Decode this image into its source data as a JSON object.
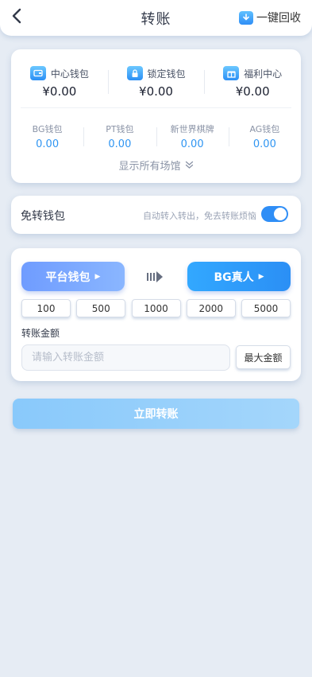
{
  "header": {
    "title": "转账",
    "recall_label": "一键回收"
  },
  "wallets": {
    "main": [
      {
        "name": "中心钱包",
        "amount": "¥0.00",
        "icon": "wallet-icon"
      },
      {
        "name": "锁定钱包",
        "amount": "¥0.00",
        "icon": "lock-icon"
      },
      {
        "name": "福利中心",
        "amount": "¥0.00",
        "icon": "gift-icon"
      }
    ],
    "sub": [
      {
        "name": "BG钱包",
        "amount": "0.00"
      },
      {
        "name": "PT钱包",
        "amount": "0.00"
      },
      {
        "name": "新世界棋牌",
        "amount": "0.00"
      },
      {
        "name": "AG钱包",
        "amount": "0.00"
      }
    ],
    "show_all_label": "显示所有场馆"
  },
  "free_transfer": {
    "title": "免转钱包",
    "desc": "自动转入转出，免去转账烦恼",
    "enabled": true
  },
  "transfer": {
    "from_label": "平台钱包",
    "to_label": "BG真人",
    "amount_options": [
      "100",
      "500",
      "1000",
      "2000",
      "5000"
    ],
    "amount_label": "转账金额",
    "amount_placeholder": "请输入转账金额",
    "max_label": "最大金额"
  },
  "submit_label": "立即转账",
  "colors": {
    "accent": "#2f8ef6",
    "sub_amount": "#2f95f2",
    "background": "#e6ecf4"
  }
}
